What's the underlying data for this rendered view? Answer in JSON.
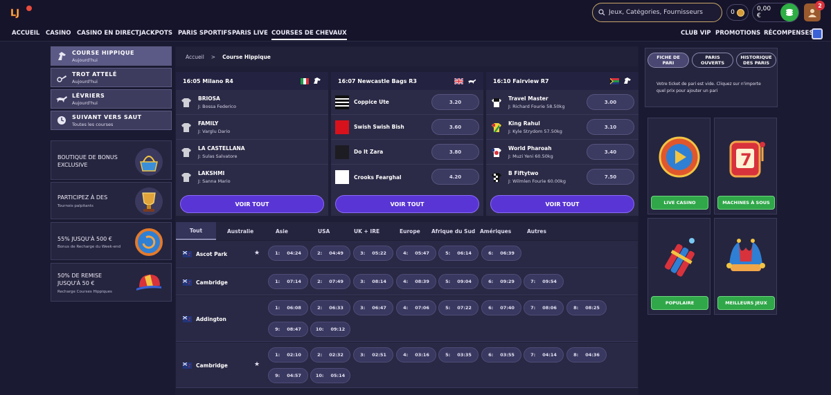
{
  "header": {
    "search_placeholder": "Jeux, Catégories, Fournisseurs",
    "coins": "0",
    "balance": "0,00 €",
    "notifications": "2"
  },
  "nav": [
    {
      "label": "ACCUEIL"
    },
    {
      "label": "CASINO"
    },
    {
      "label": "CASINO EN DIRECT"
    },
    {
      "label": "JACKPOTS"
    },
    {
      "label": "PARIS SPORTIFS"
    },
    {
      "label": "PARIS LIVE"
    },
    {
      "label": "COURSES DE CHEVAUX"
    },
    {
      "label": "CLUB VIP"
    },
    {
      "label": "PROMOTIONS"
    },
    {
      "label": "RÉCOMPENSES"
    }
  ],
  "sidebar": {
    "categories": [
      {
        "title": "COURSE HIPPIQUE",
        "sub": "Aujourd'hui"
      },
      {
        "title": "TROT ATTELÉ",
        "sub": "Aujourd'hui"
      },
      {
        "title": "LÉVRIERS",
        "sub": "Aujourd'hui"
      },
      {
        "title": "SUIVANT VERS SAUT",
        "sub": "Toutes les courses"
      }
    ],
    "promos": [
      {
        "title1": "BOUTIQUE DE BONUS",
        "title2": "EXCLUSIVE",
        "sub": ""
      },
      {
        "title1": "PARTICIPEZ À DES",
        "title2": "",
        "sub": "Tournois palpitants"
      },
      {
        "title1": "55% JUSQU'À 500 €",
        "title2": "",
        "sub": "Bonus de Recharge du Week-end"
      },
      {
        "title1": "50% DE REMISE",
        "title2": "JUSQU'À 50 €",
        "sub": "Recharge Courses Hippiques"
      }
    ]
  },
  "breadcrumb": {
    "home": "Accueil",
    "sep": ">",
    "current": "Course Hippique"
  },
  "races": [
    {
      "header": "16:05  Milano R4",
      "runners": [
        {
          "name": "BRIOSA",
          "jockey": "J: Bossa Federico",
          "odds": ""
        },
        {
          "name": "FAMILY",
          "jockey": "J: Varglu Dario",
          "odds": ""
        },
        {
          "name": "LA CASTELLANA",
          "jockey": "J: Sulas Salvatore",
          "odds": ""
        },
        {
          "name": "LAKSHMI",
          "jockey": "J: Sanna Mario",
          "odds": ""
        }
      ],
      "button": "VOIR TOUT"
    },
    {
      "header": "16:07  Newcastle Bags R3",
      "runners": [
        {
          "name": "Coppice Ute",
          "jockey": "",
          "odds": "3.20"
        },
        {
          "name": "Swish Swish Bish",
          "jockey": "",
          "odds": "3.60"
        },
        {
          "name": "Do It Zara",
          "jockey": "",
          "odds": "3.80"
        },
        {
          "name": "Crooks Fearghal",
          "jockey": "",
          "odds": "4.20"
        }
      ],
      "button": "VOIR TOUT"
    },
    {
      "header": "16:10  Fairview R7",
      "runners": [
        {
          "name": "Travel Master",
          "jockey": "J: Richard Fourie 58.50kg",
          "odds": "3.00"
        },
        {
          "name": "King Rahul",
          "jockey": "J: Kyle Strydom 57.50kg",
          "odds": "3.10"
        },
        {
          "name": "World Pharoah",
          "jockey": "J: Muzi Yeni 60.50kg",
          "odds": "3.40"
        },
        {
          "name": "B Fiftytwo",
          "jockey": "J: Wilmlen Fourie 60.00kg",
          "odds": "7.50"
        }
      ],
      "button": "VOIR TOUT"
    }
  ],
  "region_tabs": [
    "Tout",
    "Australie",
    "Asie",
    "USA",
    "UK + IRE",
    "Europe",
    "Afrique du Sud",
    "Amériques",
    "Autres"
  ],
  "meetings": [
    {
      "name": "Ascot Park",
      "star": true,
      "races": [
        [
          "1:",
          "04:24"
        ],
        [
          "2:",
          "04:49"
        ],
        [
          "3:",
          "05:22"
        ],
        [
          "4:",
          "05:47"
        ],
        [
          "5:",
          "06:14"
        ],
        [
          "6:",
          "06:39"
        ]
      ]
    },
    {
      "name": "Cambridge",
      "star": false,
      "races": [
        [
          "1:",
          "07:14"
        ],
        [
          "2:",
          "07:49"
        ],
        [
          "3:",
          "08:14"
        ],
        [
          "4:",
          "08:39"
        ],
        [
          "5:",
          "09:04"
        ],
        [
          "6:",
          "09:29"
        ],
        [
          "7:",
          "09:54"
        ]
      ]
    },
    {
      "name": "Addington",
      "star": false,
      "races": [
        [
          "1:",
          "06:08"
        ],
        [
          "2:",
          "06:33"
        ],
        [
          "3:",
          "06:47"
        ],
        [
          "4:",
          "07:06"
        ],
        [
          "5:",
          "07:22"
        ],
        [
          "6:",
          "07:40"
        ],
        [
          "7:",
          "08:06"
        ],
        [
          "8:",
          "08:25"
        ],
        [
          "9:",
          "08:47"
        ],
        [
          "10:",
          "09:12"
        ]
      ]
    },
    {
      "name": "Cambridge",
      "star": true,
      "races": [
        [
          "1:",
          "02:10"
        ],
        [
          "2:",
          "02:32"
        ],
        [
          "3:",
          "02:51"
        ],
        [
          "4:",
          "03:16"
        ],
        [
          "5:",
          "03:35"
        ],
        [
          "6:",
          "03:55"
        ],
        [
          "7:",
          "04:14"
        ],
        [
          "8:",
          "04:36"
        ],
        [
          "9:",
          "04:57"
        ],
        [
          "10:",
          "05:14"
        ]
      ]
    }
  ],
  "betslip": {
    "tabs": [
      [
        "FICHE DE",
        "PARI"
      ],
      [
        "PARIS",
        "OUVERTS"
      ],
      [
        "HISTORIQUE",
        "DES PARIS"
      ]
    ],
    "empty1": "Votre ticket de pari est vide. Cliquez sur n'importe",
    "empty2": "quel prix pour ajouter un pari"
  },
  "tiles": [
    "LIVE CASINO",
    "MACHINES À SOUS",
    "POPULAIRE",
    "MEILLEURS JEUX"
  ]
}
